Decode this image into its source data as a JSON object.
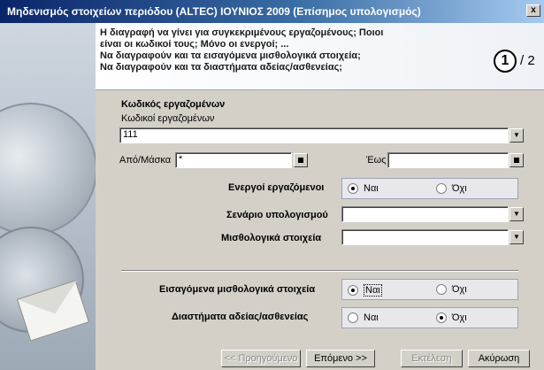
{
  "window": {
    "title": "Μηδενισμός στοιχείων περιόδου (ALTEC)   ΙΟΥΝΙΟΣ 2009   (Επίσημος υπολογισμός)",
    "close_glyph": "x"
  },
  "header": {
    "lines": [
      "Η διαγραφή να γίνει για συγκεκριμένους εργαζομένους; Ποιοι",
      "είναι οι κωδικοί τους; Μόνο οι ενεργοί; ...",
      "Να διαγραφούν και τα εισαγόμενα μισθολογικά στοιχεία;",
      "Να διαγραφούν και τα διαστήματα αδείας/ασθενείας;"
    ],
    "step_current": "1",
    "step_total": "/ 2"
  },
  "form": {
    "section_title": "Κωδικός εργαζομένων",
    "codes_label": "Κωδικοί εργαζομένων",
    "codes_value": "111",
    "from_label": "Από/Μάσκα",
    "from_value": "*",
    "to_label": "Έως",
    "to_value": "",
    "active_label": "Ενεργοί εργαζόμενοι",
    "active_yes": "Ναι",
    "active_no": "Όχι",
    "scenario_label": "Σενάριο υπολογισμού",
    "scenario_value": "",
    "payroll_label": "Μισθολογικά στοιχεία",
    "payroll_value": "",
    "imported_label": "Εισαγόμενα μισθολογικά στοιχεία",
    "imported_yes": "Ναι",
    "imported_no": "Όχι",
    "leave_label": "Διαστήματα αδείας/ασθενείας",
    "leave_yes": "Ναι",
    "leave_no": "Όχι",
    "dropdown_glyph": "▼"
  },
  "footer": {
    "prev": "<< Προηγούμενο",
    "next": "Επόμενο >>",
    "run": "Εκτέλεση",
    "cancel": "Ακύρωση"
  }
}
